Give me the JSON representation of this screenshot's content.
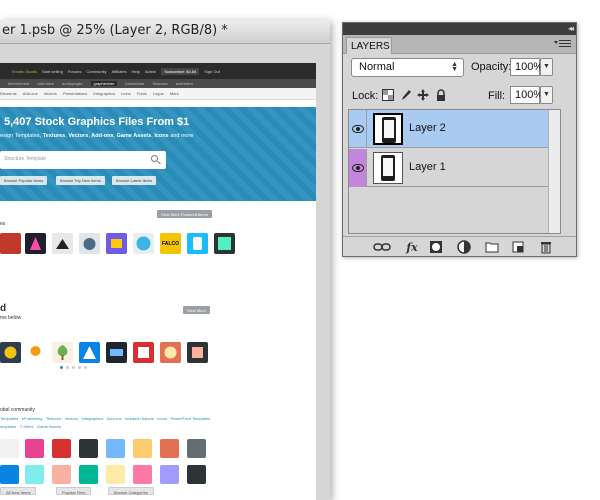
{
  "document": {
    "title": "er 1.psb @ 25% (Layer 2, RGB/8) *"
  },
  "website": {
    "topbar": [
      "Envato Studio",
      "Start selling",
      "Forums",
      "Community",
      "Affiliates",
      "Help",
      "Admin",
      "Sushantshi: $4.84",
      "Sign Out"
    ],
    "marketplaces": [
      "themeforest",
      "videohive",
      "audiojungle",
      "graphicriver",
      "photodune",
      "3docean",
      "activeden"
    ],
    "active_marketplace": "graphicriver",
    "categories": [
      "Elements",
      "Add-ons",
      "Vectors",
      "Presentations",
      "Infographics",
      "Icons",
      "Fonts",
      "Logos",
      "More"
    ],
    "hero_title": "5,407 Stock Graphics Files From $1",
    "hero_sub_parts": [
      "esign Templates",
      ", ",
      "Textures",
      ", ",
      "Vectors",
      ", ",
      "Add-ons",
      ", ",
      "Game Assets",
      ", ",
      "Icons",
      " and more"
    ],
    "search_placeholder": "Structure Template",
    "hero_buttons": [
      "Browse Popular Items",
      "Browse Top New Items",
      "Browse Latest Items"
    ],
    "featured_label": "es",
    "featured_button": "View More Featured Items",
    "thumb_label_text": "FALCO",
    "section_head": "d",
    "section_sub": "ms below",
    "view_more_button": "View More",
    "community_label": "obal community",
    "links_row1": "Templates · ePublishing · Textures · Vectors · Infographics · Add-ons · Isolated Objects · Icons · PowerPoint Templates",
    "links_row2": "emplates · T-Shirts · Game Assets",
    "footer_buttons": [
      "All New Items",
      "Popular Files",
      "Browse Categories"
    ]
  },
  "layers_panel": {
    "tab_label": "LAYERS",
    "blend_mode": "Normal",
    "opacity_label": "Opacity:",
    "opacity_value": "100%",
    "lock_label": "Lock:",
    "fill_label": "Fill:",
    "fill_value": "100%",
    "layers": [
      {
        "name": "Layer 2",
        "selected": true,
        "visible": true
      },
      {
        "name": "Layer 1",
        "selected": false,
        "visible": true
      }
    ],
    "footer_icons": [
      "link-icon",
      "fx-icon",
      "mask-icon",
      "adjustment-icon",
      "folder-icon",
      "new-layer-icon",
      "trash-icon"
    ],
    "fx_label": "fx"
  },
  "colors": {
    "hero_blue": "#2a8fbd",
    "selected_layer": "#a9cbf2",
    "color_label_purple": "#c486dc",
    "panel_bg": "#d6d6d6"
  }
}
